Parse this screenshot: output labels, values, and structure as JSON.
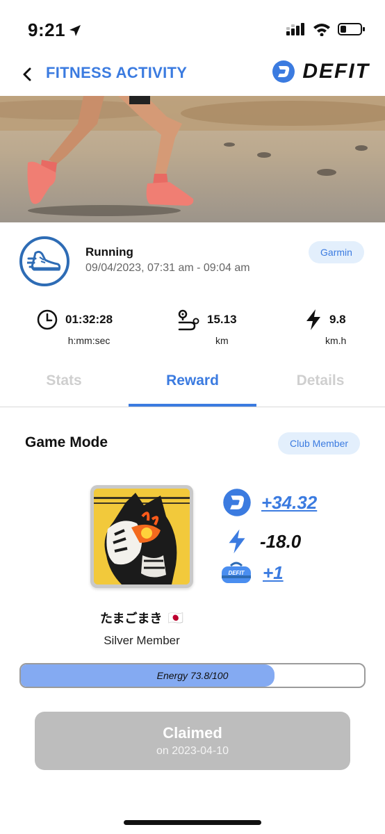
{
  "status_bar": {
    "time": "9:21"
  },
  "header": {
    "title": "FITNESS ACTIVITY",
    "brand": "DEFIT"
  },
  "activity": {
    "type": "Running",
    "datetime": "09/04/2023, 07:31 am - 09:04 am",
    "source": "Garmin",
    "metrics": [
      {
        "value": "01:32:28",
        "unit": "h:mm:sec",
        "icon": "clock-icon"
      },
      {
        "value": "15.13",
        "unit": "km",
        "icon": "route-icon"
      },
      {
        "value": "9.8",
        "unit": "km.h",
        "icon": "lightning-icon"
      }
    ]
  },
  "tabs": [
    {
      "label": "Stats",
      "active": false
    },
    {
      "label": "Reward",
      "active": true
    },
    {
      "label": "Details",
      "active": false
    }
  ],
  "game": {
    "title": "Game Mode",
    "membership_badge": "Club Member",
    "rewards": [
      {
        "value": "+34.32",
        "icon": "defit-token-icon"
      },
      {
        "value": "-18.0",
        "icon": "lightning-icon"
      },
      {
        "value": "+1",
        "icon": "mystery-bag-icon",
        "bag_label": "DEFIT"
      }
    ],
    "username": "たまごまき",
    "flag": "🇯🇵",
    "member_level": "Silver Member",
    "energy": {
      "label": "Energy 73.8/100",
      "current": 73.8,
      "max": 100
    }
  },
  "claim": {
    "title": "Claimed",
    "subtitle": "on 2023-04-10"
  },
  "colors": {
    "accent": "#3b7be0",
    "badge_bg": "#e3effc",
    "energy_fill": "#84aaf2",
    "claim_bg": "#bdbdbd",
    "activity_ring": "#2e6cb5"
  }
}
